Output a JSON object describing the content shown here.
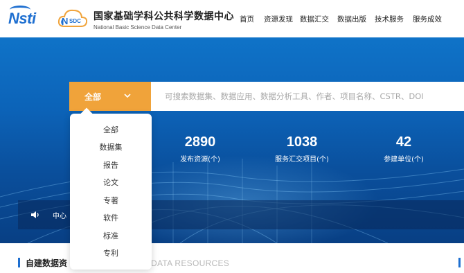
{
  "header": {
    "logo_nsti": "Nsti",
    "logo_nsdc": "SDC",
    "logo_nsdc_initial": "N",
    "brand_cn": "国家基础学科公共科学数据中心",
    "brand_en": "National Basic Science Data Center",
    "nav": [
      "首页",
      "资源发现",
      "数据汇交",
      "数据出版",
      "技术服务",
      "服务成效"
    ]
  },
  "search": {
    "selected": "全部",
    "placeholder": "可搜索数据集、数据应用、数据分析工具、作者、项目名称、CSTR、DOI",
    "options": [
      "全部",
      "数据集",
      "报告",
      "论文",
      "专著",
      "软件",
      "标准",
      "专利"
    ]
  },
  "stats": [
    {
      "value": "2890",
      "label": "发布资源(个)"
    },
    {
      "value": "1038",
      "label": "服务汇交项目(个)"
    },
    {
      "value": "42",
      "label": "参建单位(个)"
    }
  ],
  "notice": {
    "text": "中心"
  },
  "section": {
    "title": "自建数据资",
    "subtitle": "DATA RESOURCES"
  },
  "colors": {
    "brand_blue": "#1e6fd0",
    "accent_orange": "#f0a33a",
    "hero_blue": "#0c63b8"
  }
}
